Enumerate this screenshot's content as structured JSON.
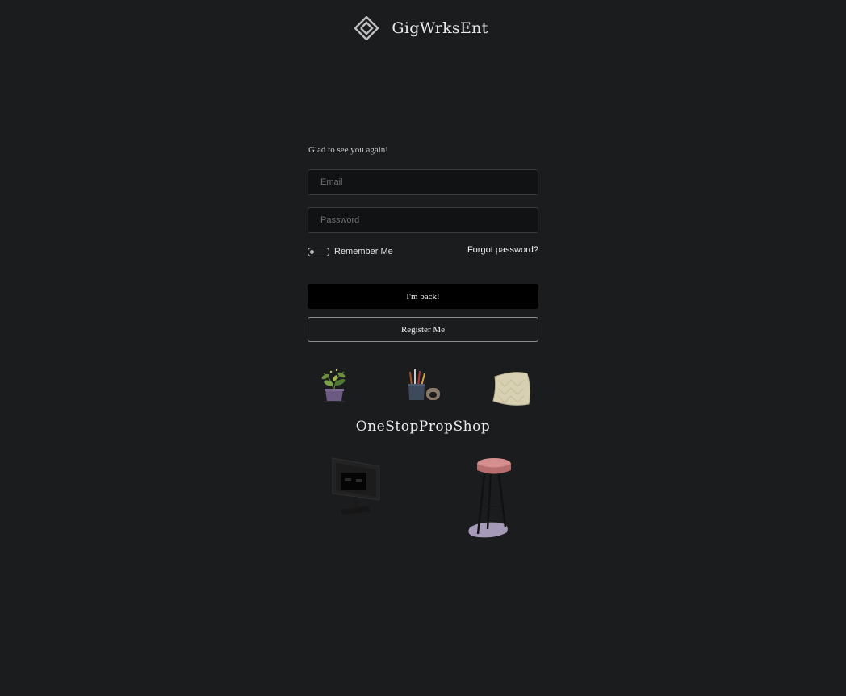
{
  "brand": {
    "name": "GigWrksEnt",
    "logo_icon": "diamond-logo-icon"
  },
  "login": {
    "greeting": "Glad to see you again!",
    "email": {
      "placeholder": "Email",
      "value": ""
    },
    "password": {
      "placeholder": "Password",
      "value": ""
    },
    "remember_label": "Remember Me",
    "remember_checked": false,
    "forgot_label": "Forgot password?",
    "submit_label": "I'm back!",
    "register_label": "Register Me"
  },
  "shop": {
    "title": "OneStopPropShop",
    "props": [
      "potted-plant-icon",
      "pencil-cup-icon",
      "pillow-icon",
      "monitor-icon",
      "bar-stool-icon"
    ]
  },
  "colors": {
    "background": "#1b1c1e",
    "input_bg": "#111213",
    "primary_button": "#000000",
    "border": "#3a3b3d"
  }
}
